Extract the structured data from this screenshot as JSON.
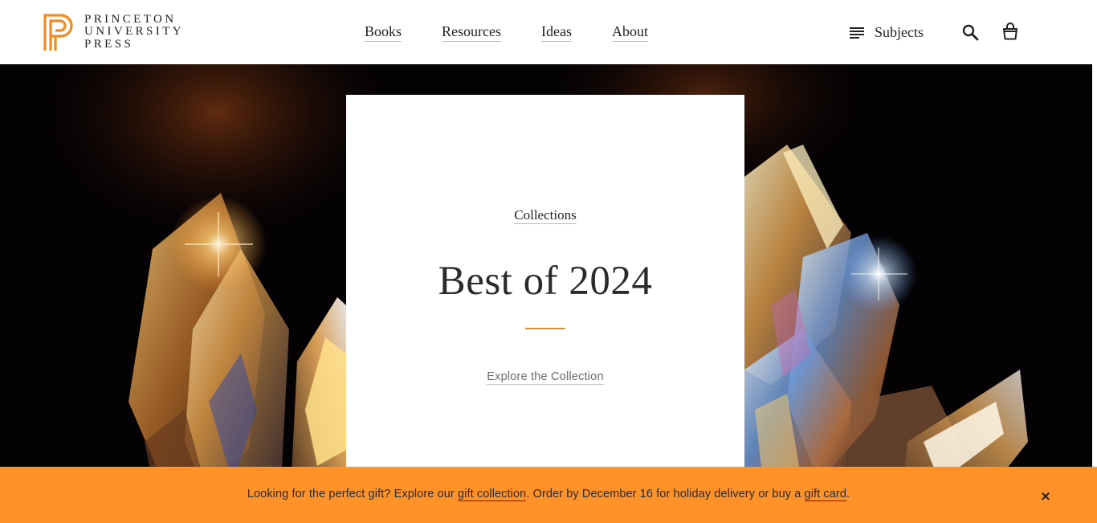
{
  "brand": {
    "logo_lines": [
      "PRINCETON",
      "UNIVERSITY",
      "PRESS"
    ],
    "accent_color": "#f08a24"
  },
  "nav": {
    "items": [
      {
        "label": "Books"
      },
      {
        "label": "Resources"
      },
      {
        "label": "Ideas"
      },
      {
        "label": "About"
      }
    ],
    "subjects_label": "Subjects",
    "subjects_icon": "menu-lines-icon",
    "search_icon": "search-icon",
    "cart_icon": "shopping-bag-icon"
  },
  "hero": {
    "background_description_colors": [
      "#040204",
      "#e8a040",
      "#9fd0ff"
    ],
    "card": {
      "eyebrow": "Collections",
      "title": "Best of 2024",
      "rule_color": "#e0922e",
      "cta": "Explore the Collection"
    }
  },
  "banner": {
    "text_1": "Looking for the perfect gift? Explore our",
    "link_1": "gift collection",
    "text_2": ". Order by December 16 for holiday delivery or buy a ",
    "link_2": "gift card",
    "text_3": ".",
    "close_icon": "close-icon",
    "close_glyph": "×",
    "background_color": "#ff9329"
  }
}
